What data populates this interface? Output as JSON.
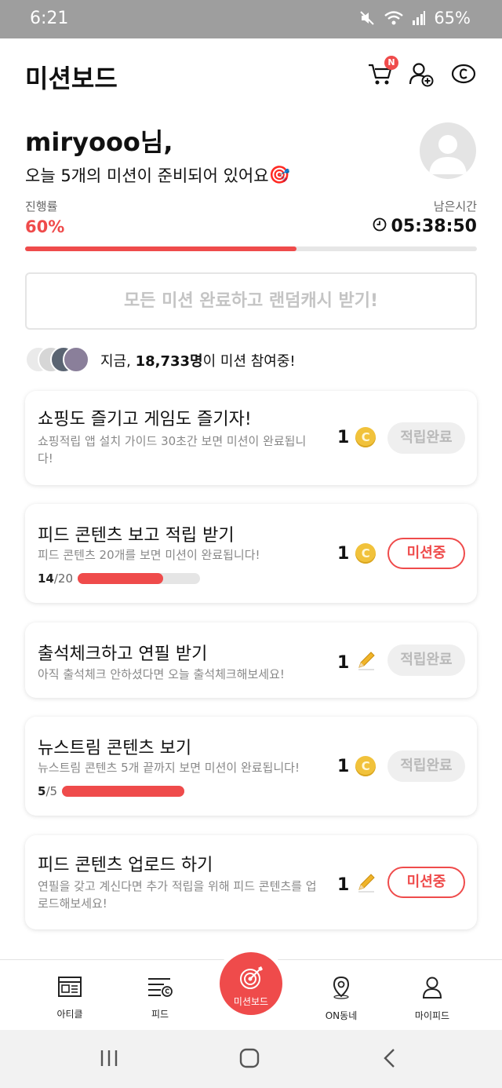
{
  "status_bar": {
    "time": "6:21",
    "battery": "65%",
    "icons": [
      "mute-icon",
      "wifi-icon",
      "signal-icon"
    ]
  },
  "header": {
    "title": "미션보드",
    "cart_badge": "N",
    "icons": [
      "cart-icon",
      "add-friend-icon",
      "cash-icon"
    ]
  },
  "greeting": {
    "name": "miryooo님,",
    "message": "오늘 5개의 미션이 준비되어 있어요",
    "emoji": "🎯"
  },
  "progress": {
    "label": "진행률",
    "percent_text": "60%",
    "percent": 0.6,
    "remaining_label": "남은시간",
    "remaining_time": "05:38:50"
  },
  "complete_all_button": "모든 미션 완료하고 랜덤캐시 받기!",
  "participants": {
    "prefix": "지금, ",
    "count": "18,733명",
    "suffix": "이 미션 참여중!"
  },
  "missions": [
    {
      "title": "쇼핑도 즐기고 게임도 즐기자!",
      "desc": "쇼핑적립 앱 설치 가이드 30초간 보면 미션이 완료됩니다!",
      "reward": "1",
      "reward_type": "coin-icon",
      "state": "적립완료",
      "state_type": "done"
    },
    {
      "title": "피드 콘텐츠 보고 적립 받기",
      "desc": "피드 콘텐츠 20개를 보면 미션이 완료됩니다!",
      "count_current": "14",
      "count_total": "/20",
      "count_progress": 0.7,
      "reward": "1",
      "reward_type": "coin-icon",
      "state": "미션중",
      "state_type": "doing"
    },
    {
      "title": "출석체크하고 연필 받기",
      "desc": "아직 출석체크 안하셨다면 오늘 출석체크해보세요!",
      "reward": "1",
      "reward_type": "pencil-icon",
      "state": "적립완료",
      "state_type": "done"
    },
    {
      "title": "뉴스트림 콘텐츠 보기",
      "desc": "뉴스트림 콘텐츠 5개 끝까지 보면 미션이 완료됩니다!",
      "count_current": "5",
      "count_total": "/5",
      "count_progress": 1.0,
      "reward": "1",
      "reward_type": "coin-icon",
      "state": "적립완료",
      "state_type": "done"
    },
    {
      "title": "피드 콘텐츠 업로드 하기",
      "desc": "연필을 갖고 계신다면 추가 적립을 위해 피드 콘텐츠를 업로드해보세요!",
      "reward": "1",
      "reward_type": "pencil-icon",
      "state": "미션중",
      "state_type": "doing"
    }
  ],
  "bottom_nav": {
    "article": "아티클",
    "feed": "피드",
    "missionboard": "미션보드",
    "on_dongne": "ON동네",
    "myfeed": "마이피드"
  },
  "colors": {
    "accent": "#ef4b4b",
    "status_bar": "#9e9e9e",
    "coin": "#f1c23b",
    "pencil": "#f0b429"
  }
}
